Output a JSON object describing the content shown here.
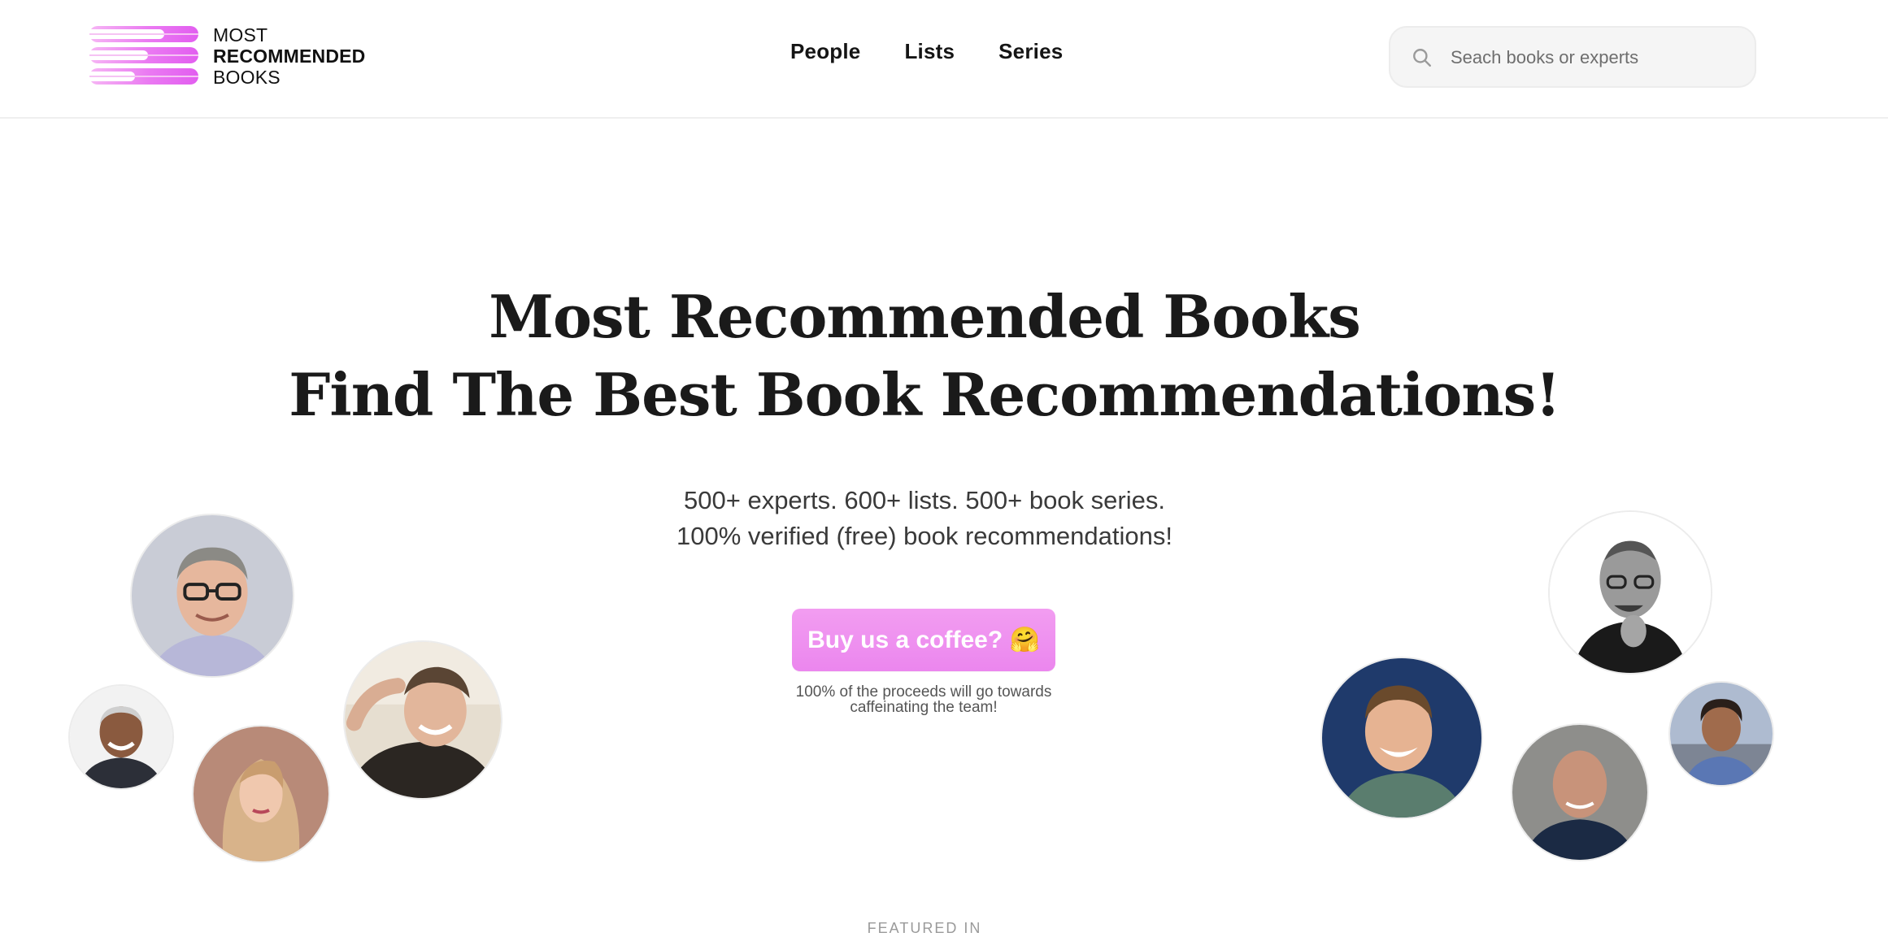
{
  "brand": {
    "line1": "MOST",
    "line2": "RECOMMENDED",
    "line3": "BOOKS",
    "colors": {
      "pink_light": "#f6b6f4",
      "pink": "#ea79f2",
      "pink_dark": "#e25ef0"
    }
  },
  "nav": [
    {
      "label": "People"
    },
    {
      "label": "Lists"
    },
    {
      "label": "Series"
    }
  ],
  "search": {
    "placeholder": "Seach books or experts",
    "icon": "search-icon"
  },
  "hero": {
    "title_line1": "Most Recommended Books",
    "title_line2": "Find The Best Book Recommendations!",
    "subtitle_line1": "500+ experts. 600+ lists. 500+ book series.",
    "subtitle_line2": "100% verified (free) book recommendations!",
    "cta_label": "Buy us a coffee? 🤗",
    "cta_note": "100% of the proceeds will go towards caffeinating the team!",
    "featured_label": "FEATURED IN"
  },
  "colors": {
    "cta": "#eb86ee",
    "title": "#1a1a1a",
    "text": "#3a3a3a"
  }
}
